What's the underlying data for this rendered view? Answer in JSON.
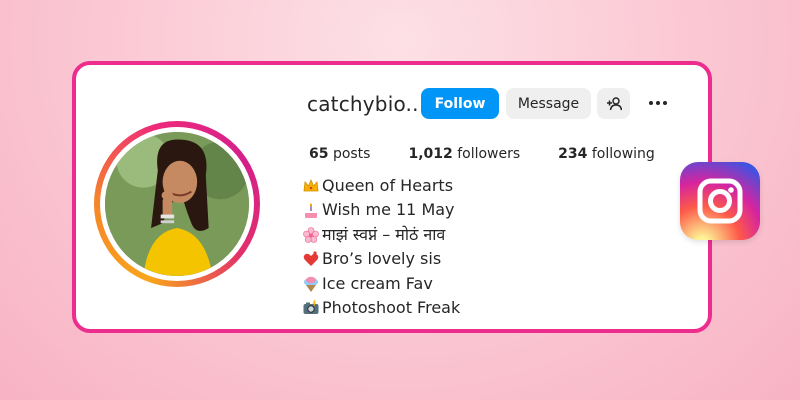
{
  "profile": {
    "username": "catchybio..",
    "follow_label": "Follow",
    "message_label": "Message",
    "stats": {
      "posts_count": "65",
      "posts_label": "posts",
      "followers_count": "1,012",
      "followers_label": "followers",
      "following_count": "234",
      "following_label": "following"
    },
    "bio": [
      {
        "icon": "crown-icon",
        "text": "Queen of Hearts"
      },
      {
        "icon": "birthday-cake-icon",
        "text": " Wish me 11 May"
      },
      {
        "icon": "cherry-blossom-icon",
        "text": "माझं स्वप्नं – मोठं नाव"
      },
      {
        "icon": "heart-exclamation-icon",
        "text": "Bro’s lovely sis"
      },
      {
        "icon": "ice-cream-icon",
        "text": "Ice cream Fav"
      },
      {
        "icon": "camera-flash-icon",
        "text": "Photoshoot Freak"
      }
    ]
  },
  "icons": {
    "add_user": "add-user-icon",
    "more": "more-options-icon",
    "brand": "instagram-logo-icon"
  },
  "colors": {
    "card_border": "#ec2d8d",
    "follow_button": "#0095f6",
    "secondary_button": "#efefef",
    "text": "#262626"
  }
}
